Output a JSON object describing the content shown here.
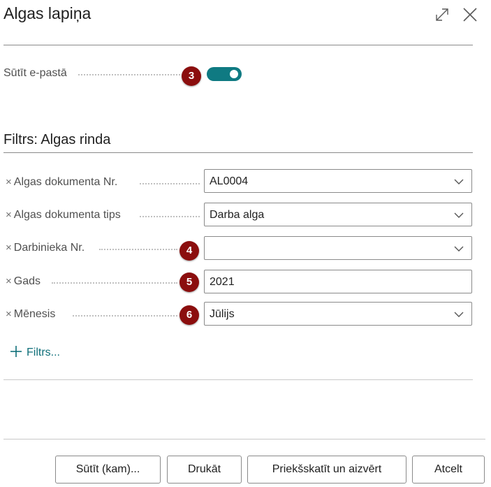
{
  "dialog": {
    "title": "Algas lapiņa"
  },
  "options": {
    "send_email_label": "Sūtīt e-pastā",
    "send_email_enabled": true,
    "badge": "3"
  },
  "filter_section": {
    "title": "Filtrs: Algas rinda",
    "rows": [
      {
        "label": "Algas dokumenta Nr.",
        "value": "AL0004",
        "badge": ""
      },
      {
        "label": "Algas dokumenta tips",
        "value": "Darba alga",
        "badge": ""
      },
      {
        "label": "Darbinieka Nr.",
        "value": "",
        "badge": "4"
      },
      {
        "label": "Gads",
        "value": "2021",
        "badge": "5"
      },
      {
        "label": "Mēnesis",
        "value": "Jūlijs",
        "badge": "6"
      }
    ],
    "remove_glyph": "×",
    "add_filter_label": "Filtrs..."
  },
  "footer": {
    "send_to_label": "Sūtīt (kam)...",
    "print_label": "Drukāt",
    "preview_close_label": "Priekšskatīt un aizvērt",
    "cancel_label": "Atcelt"
  }
}
